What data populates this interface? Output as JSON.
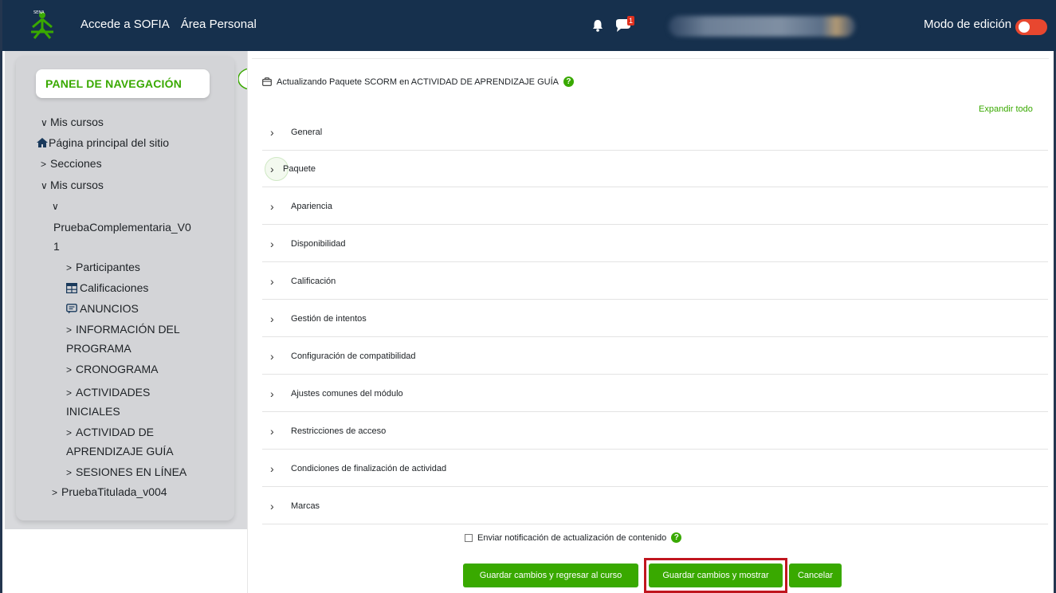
{
  "navbar": {
    "links": [
      "Accede a SOFIA",
      "Área Personal"
    ],
    "edit_mode_label": "Modo de edición",
    "message_badge": "1"
  },
  "sidebar": {
    "title": "PANEL DE NAVEGACIÓN",
    "items": [
      {
        "chevron": "∨",
        "label": "Mis cursos"
      },
      {
        "icon": "home-icon",
        "label": "Página principal del sitio"
      },
      {
        "chevron": ">",
        "label": "Secciones"
      },
      {
        "chevron": "∨",
        "label": "Mis cursos"
      },
      {
        "chevron": "∨",
        "label": ""
      },
      {
        "label": "PruebaComplementaria_V0"
      },
      {
        "label": "1"
      },
      {
        "chevron": ">",
        "label": "Participantes"
      },
      {
        "icon": "table-icon",
        "label": "Calificaciones"
      },
      {
        "icon": "forum-icon",
        "label": "ANUNCIOS"
      },
      {
        "chevron": ">",
        "label": "INFORMACIÓN DEL"
      },
      {
        "label": "PROGRAMA"
      },
      {
        "chevron": ">",
        "label": "CRONOGRAMA"
      },
      {
        "chevron": ">",
        "label": "ACTIVIDADES"
      },
      {
        "label": "INICIALES"
      },
      {
        "chevron": ">",
        "label": "ACTIVIDAD DE"
      },
      {
        "label": "APRENDIZAJE GUÍA"
      },
      {
        "chevron": ">",
        "label": "SESIONES EN LÍNEA"
      },
      {
        "chevron": ">",
        "label": "PruebaTitulada_v004"
      }
    ]
  },
  "main": {
    "heading": "Actualizando Paquete SCORM en ACTIVIDAD DE APRENDIZAJE GUÍA",
    "expand_all": "Expandir todo",
    "sections": [
      "General",
      "Paquete",
      "Apariencia",
      "Disponibilidad",
      "Calificación",
      "Gestión de intentos",
      "Configuración de compatibilidad",
      "Ajustes comunes del módulo",
      "Restricciones de acceso",
      "Condiciones de finalización de actividad",
      "Marcas"
    ],
    "notify_label": "Enviar notificación de actualización de contenido",
    "buttons": {
      "save_return": "Guardar cambios y regresar al curso",
      "save_show": "Guardar cambios y mostrar",
      "cancel": "Cancelar"
    }
  },
  "colors": {
    "navbar": "#16304d",
    "accent_green": "#39a900",
    "highlight_red": "#c0161f",
    "toggle": "#e8472f"
  }
}
